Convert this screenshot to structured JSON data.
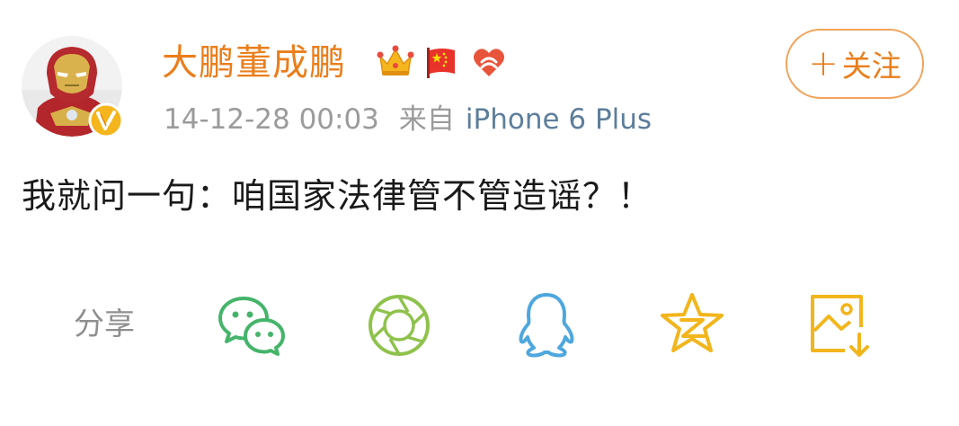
{
  "user": {
    "name": "大鹏董成鹏",
    "avatar_icon": "avatar-iron-man",
    "verified_icon": "verified-v-badge",
    "badges": [
      "crown-icon",
      "china-flag-icon",
      "charity-heart-icon"
    ]
  },
  "follow_button": {
    "plus": "+",
    "label": "关注"
  },
  "meta": {
    "timestamp": "14-12-28 00:03",
    "from_label": "来自",
    "source": "iPhone 6 Plus"
  },
  "post": {
    "text": "我就问一句：咱国家法律管不管造谣？！"
  },
  "share": {
    "label": "分享",
    "targets": [
      {
        "icon": "wechat-icon",
        "color": "#45b46a"
      },
      {
        "icon": "moments-icon",
        "color": "#8fc24c"
      },
      {
        "icon": "qq-icon",
        "color": "#4ea7de"
      },
      {
        "icon": "qzone-icon",
        "color": "#f2b51c"
      },
      {
        "icon": "save-image-icon",
        "color": "#f2b51c"
      }
    ]
  },
  "colors": {
    "name": "#ea7e1c",
    "meta": "#9b9b9b",
    "source": "#5d7e9b",
    "text": "#1a1a1a",
    "follow_border": "#f2a35b"
  }
}
